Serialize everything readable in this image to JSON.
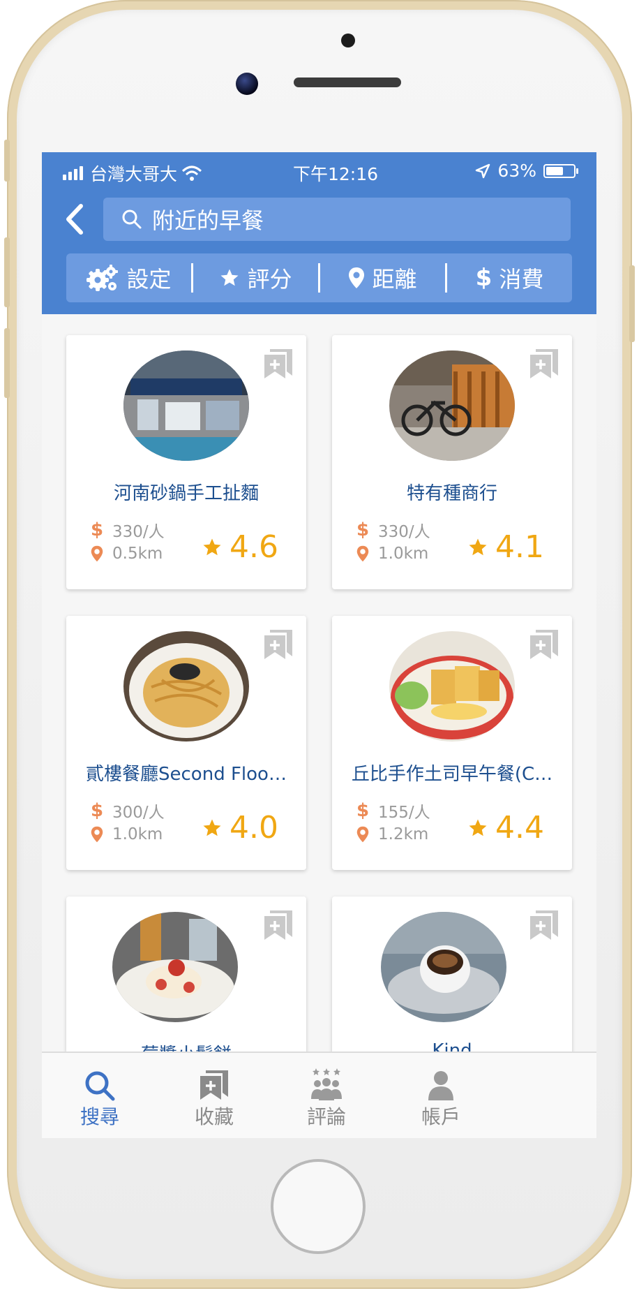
{
  "status_bar": {
    "carrier": "台灣大哥大",
    "time": "下午12:16",
    "battery": "63%",
    "battery_level": 0.63
  },
  "search": {
    "query": "附近的早餐"
  },
  "filters": [
    {
      "label": "設定",
      "icon": "gear-icon"
    },
    {
      "label": "評分",
      "icon": "star-icon"
    },
    {
      "label": "距離",
      "icon": "location-pin-icon"
    },
    {
      "label": "消費",
      "icon": "dollar-icon"
    }
  ],
  "restaurants": [
    {
      "name": "河南砂鍋手工扯麵",
      "price": "330/人",
      "distance": "0.5km",
      "rating": "4.6"
    },
    {
      "name": "特有種商行",
      "price": "330/人",
      "distance": "1.0km",
      "rating": "4.1"
    },
    {
      "name": "貳樓餐廳Second Floo…",
      "price": "300/人",
      "distance": "1.0km",
      "rating": "4.0"
    },
    {
      "name": "丘比手作土司早午餐(C…",
      "price": "155/人",
      "distance": "1.2km",
      "rating": "4.4"
    },
    {
      "name": "莓醬小鬆餅",
      "price": "",
      "distance": "",
      "rating": ""
    },
    {
      "name": "Kind",
      "price": "",
      "distance": "",
      "rating": ""
    }
  ],
  "tabs": [
    {
      "label": "搜尋",
      "icon": "search-icon",
      "active": true
    },
    {
      "label": "收藏",
      "icon": "bookmark-icon",
      "active": false
    },
    {
      "label": "評論",
      "icon": "reviews-icon",
      "active": false
    },
    {
      "label": "帳戶",
      "icon": "account-icon",
      "active": false
    }
  ],
  "colors": {
    "primary": "#4a82d0",
    "accent_star": "#f0a713",
    "price_icon": "#ec8a55",
    "name_text": "#1d4f8f"
  }
}
